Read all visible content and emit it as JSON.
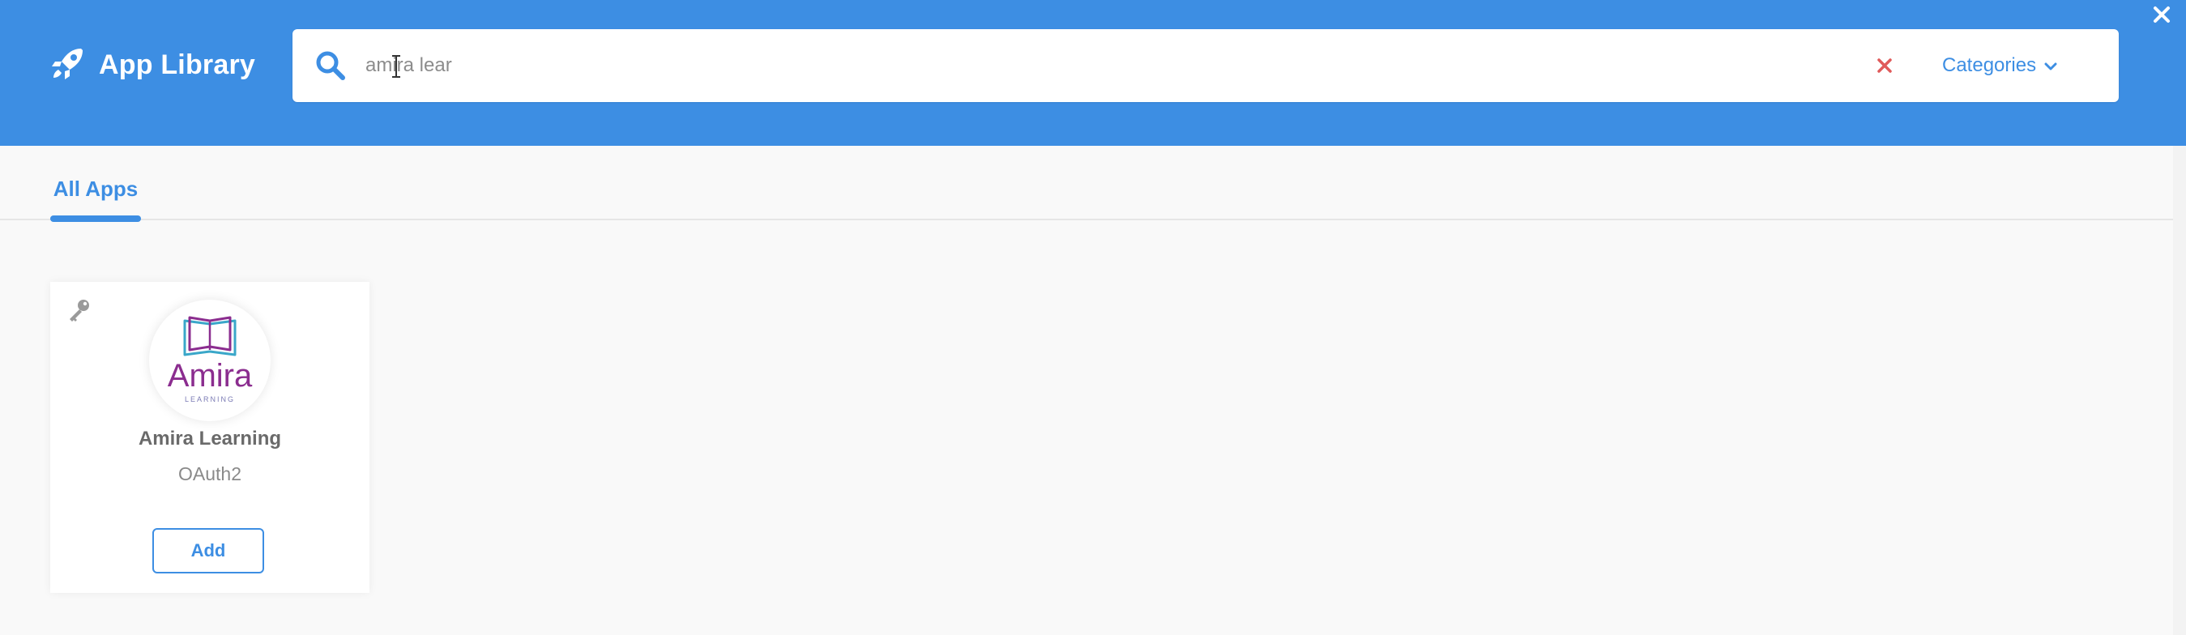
{
  "header": {
    "title": "App Library",
    "brand_icon": "rocket-icon",
    "close_icon": "close-icon",
    "color": "#3d8ee3"
  },
  "search": {
    "value": "amira lear",
    "icon": "search-icon",
    "clear_icon": "clear-x-icon",
    "clear_color": "#e05a5a"
  },
  "categories": {
    "label": "Categories",
    "icon": "chevron-down-icon"
  },
  "tabs": [
    {
      "label": "All Apps",
      "active": true
    }
  ],
  "apps": [
    {
      "name": "Amira Learning",
      "auth_type": "OAuth2",
      "logo_text": "Amira",
      "logo_subtext": "LEARNING",
      "add_label": "Add",
      "key_icon": "key-icon"
    }
  ]
}
